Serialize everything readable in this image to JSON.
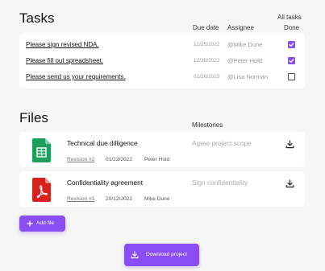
{
  "tasks": {
    "title": "Tasks",
    "headers": {
      "due_date": "Due date",
      "assignee": "Assignee",
      "all_tasks": "All tasks",
      "done": "Done"
    },
    "items": [
      {
        "name": "Please sign revised NDA.",
        "due": "12/25/2022",
        "assignee": "@Mike Dune",
        "done": true
      },
      {
        "name": "Please fill out spreadsheet.",
        "due": "12/30/2022",
        "assignee": "@Peter Hold",
        "done": true
      },
      {
        "name": "Please send us your requirements.",
        "due": "01/20/2023",
        "assignee": "@Lisa Norman",
        "done": false
      }
    ]
  },
  "files": {
    "title": "Files",
    "milestones_header": "Milestones",
    "items": [
      {
        "name": "Technical due dilligence",
        "revision": "Revision #2",
        "date": "01/22/2022",
        "owner": "Peter Hold",
        "milestone": "Agree project scope",
        "icon": "spreadsheet-icon",
        "icon_color": "#1e9e5a"
      },
      {
        "name": "Confidentiality agreement",
        "revision": "Revision #1",
        "date": "20/12/2022",
        "owner": "Mike Dune",
        "milestone": "Sign confidentiality",
        "icon": "pdf-icon",
        "icon_color": "#d8221e"
      }
    ],
    "add_label": "Add file"
  },
  "download_project_label": "Download project",
  "colors": {
    "accent": "#8a4cf3",
    "background": "#f6f6f6"
  }
}
